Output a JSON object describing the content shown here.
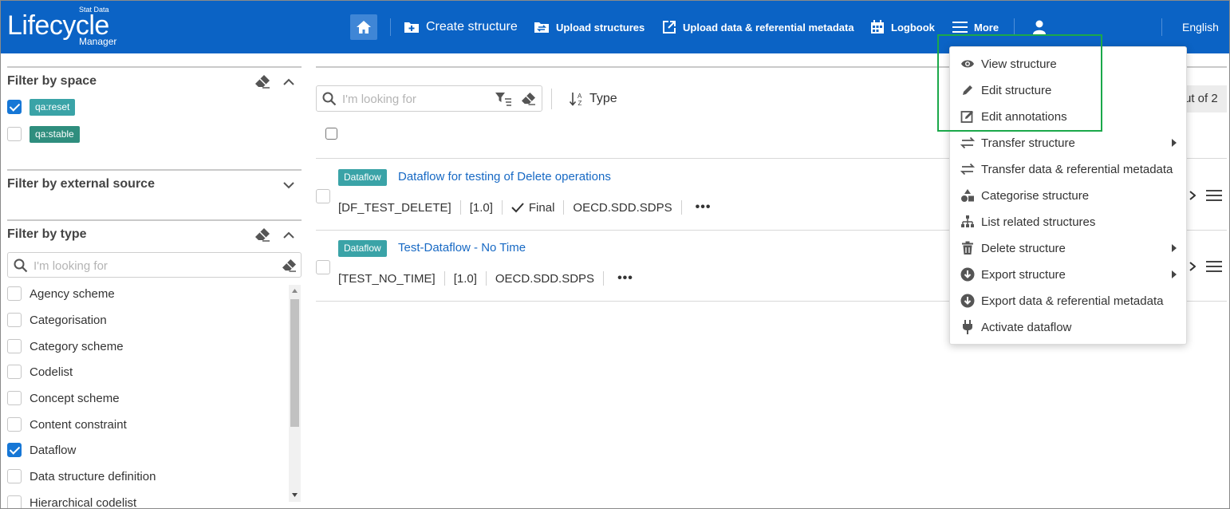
{
  "header": {
    "logo": {
      "main": "Lifecycle",
      "top": "Stat Data",
      "bottom": "Manager"
    },
    "nav": {
      "create": "Create structure",
      "upload_structures": "Upload structures",
      "upload_data": "Upload data & referential metadata",
      "logbook": "Logbook",
      "more": "More"
    },
    "language": "English",
    "brand_color": "#0b63c5"
  },
  "filters": {
    "space": {
      "title": "Filter by space",
      "items": [
        {
          "label": "qa:reset",
          "checked": true
        },
        {
          "label": "qa:stable",
          "checked": false
        }
      ]
    },
    "external_source": {
      "title": "Filter by external source"
    },
    "type": {
      "title": "Filter by type",
      "search_placeholder": "I'm looking for",
      "items": [
        {
          "label": "Agency scheme",
          "checked": false
        },
        {
          "label": "Categorisation",
          "checked": false
        },
        {
          "label": "Category scheme",
          "checked": false
        },
        {
          "label": "Codelist",
          "checked": false
        },
        {
          "label": "Concept scheme",
          "checked": false
        },
        {
          "label": "Content constraint",
          "checked": false
        },
        {
          "label": "Dataflow",
          "checked": true
        },
        {
          "label": "Data structure definition",
          "checked": false
        },
        {
          "label": "Hierarchical codelist",
          "checked": false
        }
      ]
    }
  },
  "toolbar": {
    "search_placeholder": "I'm looking for",
    "sort_label": "Type",
    "pager": "ut of 2"
  },
  "results": [
    {
      "tag": "Dataflow",
      "title": "Dataflow for testing of Delete operations",
      "id": "[DF_TEST_DELETE]",
      "version": "[1.0]",
      "status": "Final",
      "agency": "OECD.SDD.SDPS",
      "more": "•••"
    },
    {
      "tag": "Dataflow",
      "title": "Test-Dataflow - No Time",
      "id": "[TEST_NO_TIME]",
      "version": "[1.0]",
      "agency": "OECD.SDD.SDPS",
      "more": "•••"
    }
  ],
  "menu": {
    "items": [
      {
        "label": "View structure",
        "icon": "eye-icon"
      },
      {
        "label": "Edit structure",
        "icon": "pencil-icon"
      },
      {
        "label": "Edit annotations",
        "icon": "edit-box-icon"
      },
      {
        "label": "Transfer structure",
        "icon": "transfer-icon",
        "submenu": true
      },
      {
        "label": "Transfer data & referential metadata",
        "icon": "transfer-icon"
      },
      {
        "label": "Categorise structure",
        "icon": "shapes-icon"
      },
      {
        "label": "List related structures",
        "icon": "hierarchy-icon"
      },
      {
        "label": "Delete structure",
        "icon": "trash-icon",
        "submenu": true
      },
      {
        "label": "Export structure",
        "icon": "download-circle-icon",
        "submenu": true
      },
      {
        "label": "Export data & referential metadata",
        "icon": "download-circle-icon"
      },
      {
        "label": "Activate dataflow",
        "icon": "plug-icon"
      }
    ],
    "highlight_color": "#1ba84a"
  }
}
